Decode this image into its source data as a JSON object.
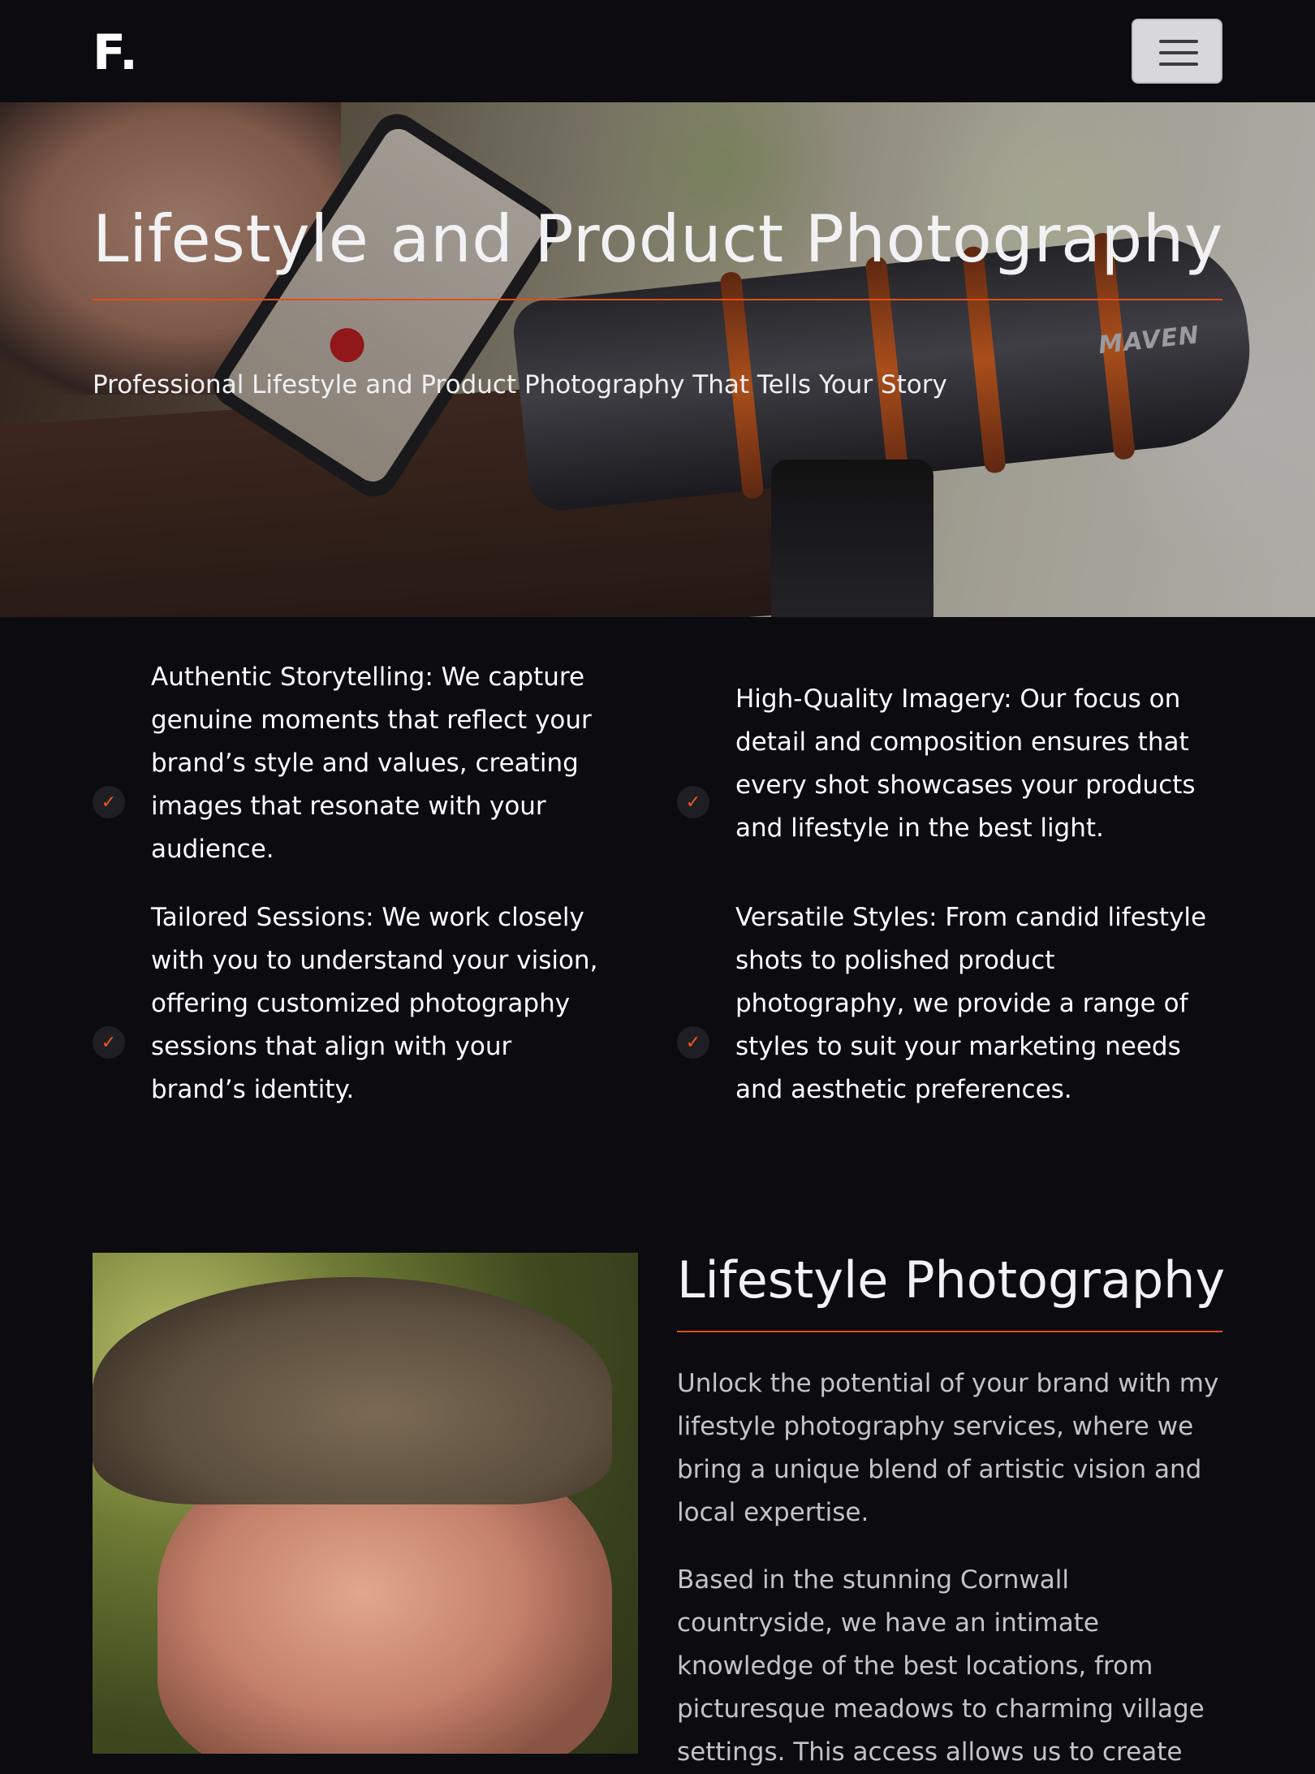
{
  "header": {
    "brand": "F.",
    "menu_icon": "hamburger-icon"
  },
  "hero": {
    "title": "Lifestyle and Product Photography",
    "subtitle": "Professional Lifestyle and Product Photography That Tells Your Story",
    "image_label": "MAVEN"
  },
  "features": [
    {
      "icon": "check-icon",
      "text": "Authentic Storytelling: We capture genuine moments that reflect your brand’s style and values, creating images that resonate with your audience."
    },
    {
      "icon": "check-icon",
      "text": "High-Quality Imagery: Our focus on detail and composition ensures that every shot showcases your products and lifestyle in the best light."
    },
    {
      "icon": "check-icon",
      "text": "Tailored Sessions: We work closely with you to understand your vision, offering customized photography sessions that align with your brand’s identity."
    },
    {
      "icon": "check-icon",
      "text": "Versatile Styles: From candid lifestyle shots to polished product photography, we provide a range of styles to suit your marketing needs and aesthetic preferences."
    }
  ],
  "about": {
    "title": "Lifestyle Photography",
    "paragraphs": [
      "Unlock the potential of your brand with my lifestyle photography services, where we bring a unique blend of artistic vision and local expertise.",
      "Based in the stunning Cornwall countryside, we have an intimate knowledge of the best locations, from picturesque meadows to charming village settings. This access allows us to create"
    ]
  },
  "colors": {
    "background": "#0b0b10",
    "accent": "#e34e1a",
    "text": "#ffffff",
    "muted_text": "#c3c3cb"
  }
}
